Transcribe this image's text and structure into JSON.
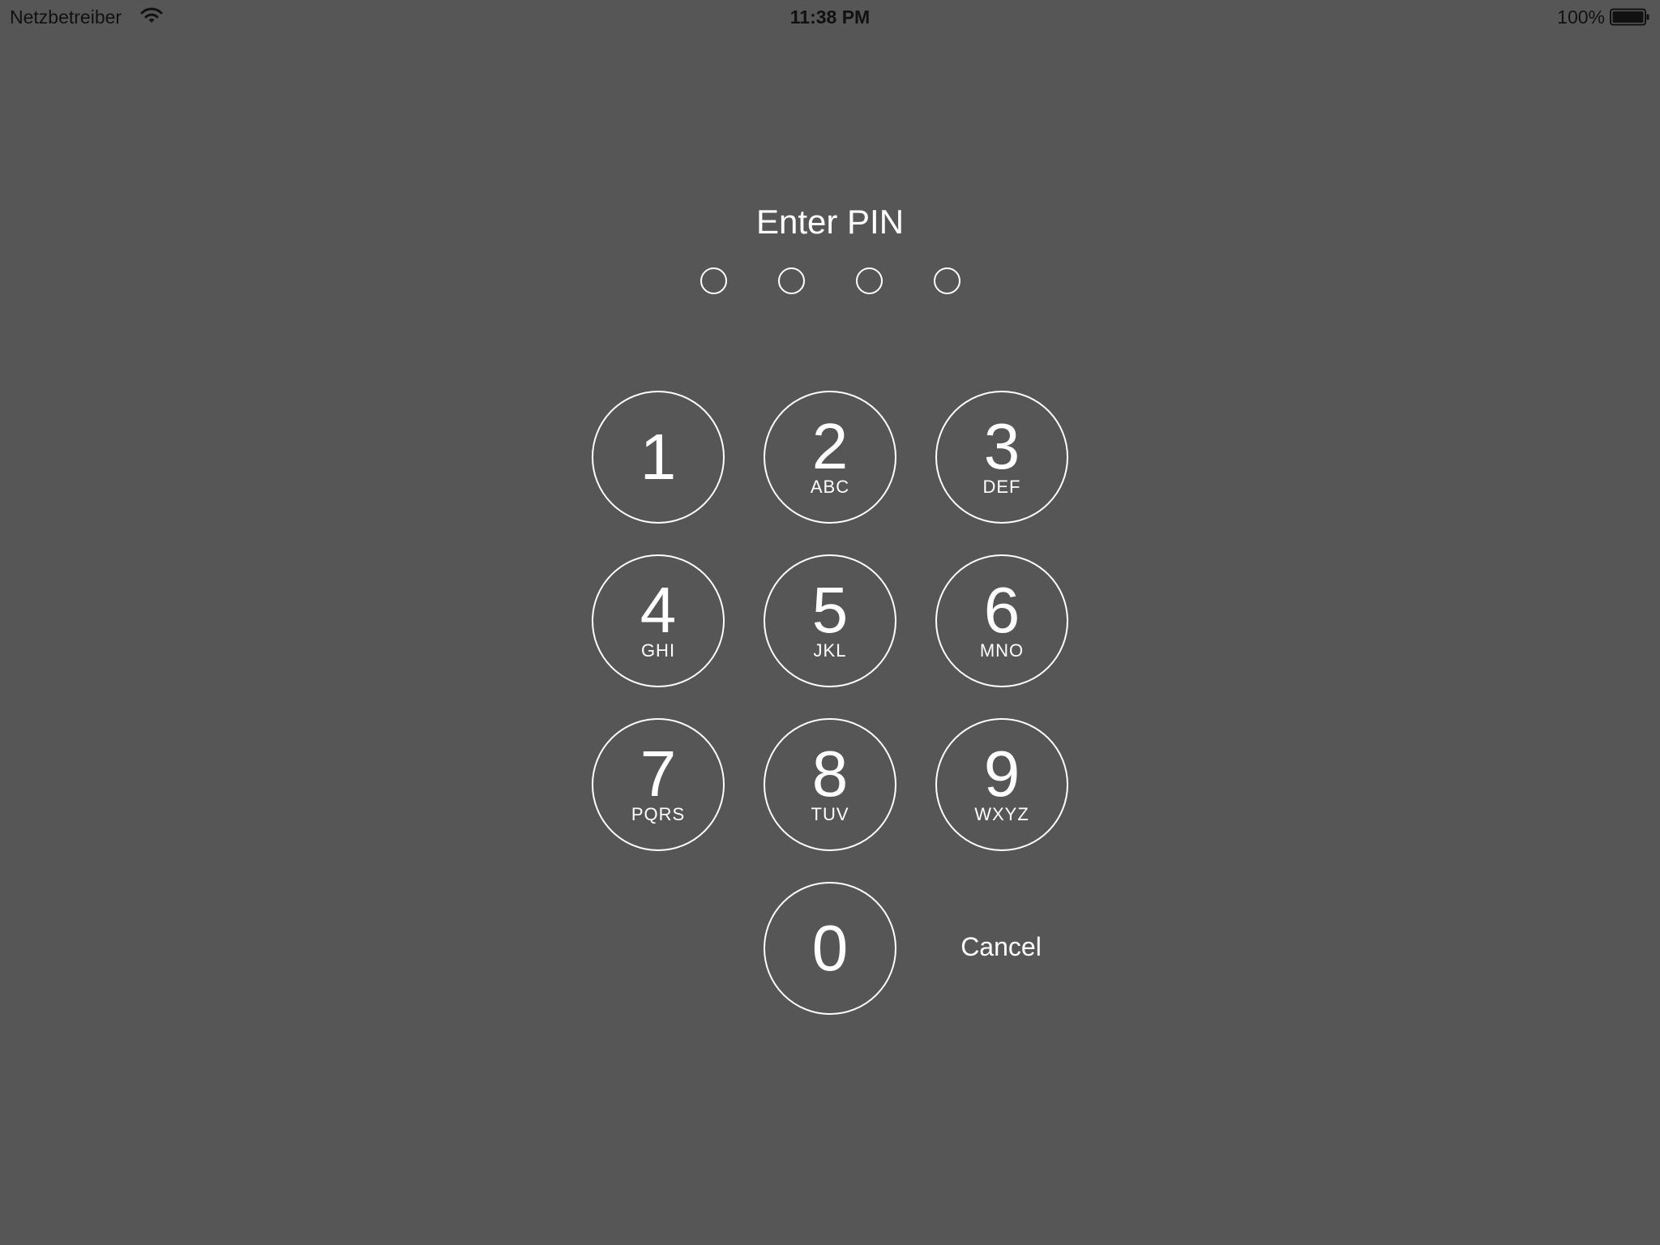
{
  "status_bar": {
    "carrier": "Netzbetreiber",
    "time": "11:38 PM",
    "battery_percent": "100%",
    "battery_level": 1.0,
    "icons": [
      "wifi-icon",
      "battery-icon"
    ]
  },
  "pin_entry": {
    "prompt": "Enter PIN",
    "digits_total": 4,
    "digits_entered": 0
  },
  "keypad": {
    "keys": [
      {
        "digit": "1",
        "letters": ""
      },
      {
        "digit": "2",
        "letters": "ABC"
      },
      {
        "digit": "3",
        "letters": "DEF"
      },
      {
        "digit": "4",
        "letters": "GHI"
      },
      {
        "digit": "5",
        "letters": "JKL"
      },
      {
        "digit": "6",
        "letters": "MNO"
      },
      {
        "digit": "7",
        "letters": "PQRS"
      },
      {
        "digit": "8",
        "letters": "TUV"
      },
      {
        "digit": "9",
        "letters": "WXYZ"
      },
      {
        "digit": "0",
        "letters": ""
      }
    ],
    "cancel_label": "Cancel"
  },
  "colors": {
    "background": "#565656",
    "foreground": "#ffffff",
    "status_text": "#111111"
  }
}
